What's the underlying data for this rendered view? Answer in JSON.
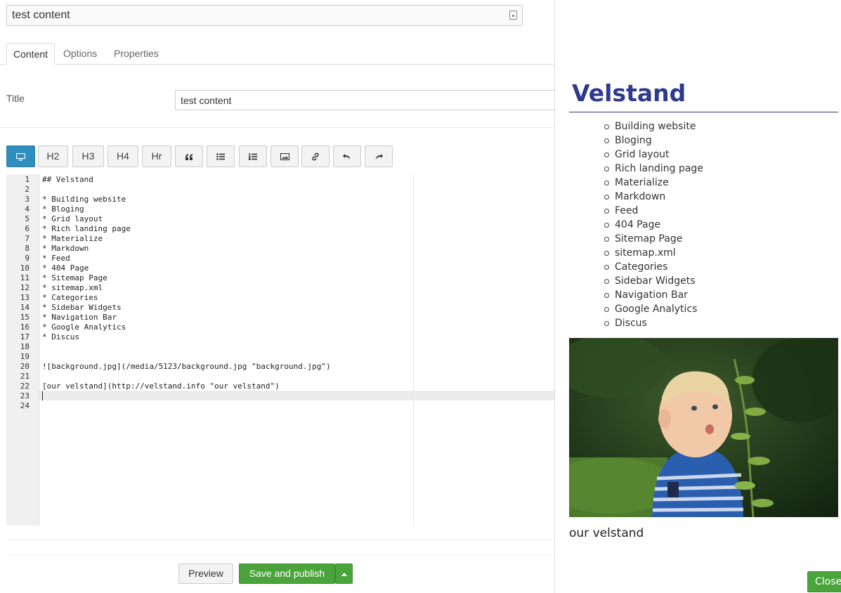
{
  "editor": {
    "name_value": "test content",
    "tabs": [
      {
        "label": "Content"
      },
      {
        "label": "Options"
      },
      {
        "label": "Properties"
      }
    ],
    "title_label": "Title",
    "title_value": "test content",
    "toolbar": {
      "preview_icon": "monitor-icon",
      "h2": "H2",
      "h3": "H3",
      "h4": "H4",
      "hr": "Hr",
      "quote_icon": "quote-icon",
      "ul_icon": "bullet-list-icon",
      "ol_icon": "numbered-list-icon",
      "image_icon": "image-icon",
      "link_icon": "link-icon",
      "undo_icon": "undo-icon",
      "redo_icon": "redo-icon"
    },
    "code_lines": [
      "## Velstand",
      "",
      "* Building website",
      "* Bloging",
      "* Grid layout",
      "* Rich landing page",
      "* Materialize",
      "* Markdown",
      "* Feed",
      "* 404 Page",
      "* Sitemap Page",
      "* sitemap.xml",
      "* Categories",
      "* Sidebar Widgets",
      "* Navigation Bar",
      "* Google Analytics",
      "* Discus",
      "",
      "",
      "![background.jpg](/media/5123/background.jpg \"background.jpg\")",
      "",
      "[our velstand](http://velstand.info \"our velstand\")",
      "",
      ""
    ],
    "line_numbers": [
      "1",
      "2",
      "3",
      "4",
      "5",
      "6",
      "7",
      "8",
      "9",
      "10",
      "11",
      "12",
      "13",
      "14",
      "15",
      "16",
      "17",
      "18",
      "19",
      "20",
      "21",
      "22",
      "23",
      "24"
    ],
    "active_line": 23,
    "buttons": {
      "preview": "Preview",
      "publish": "Save and publish"
    }
  },
  "preview": {
    "title": "Velstand",
    "items": [
      "Building website",
      "Bloging",
      "Grid layout",
      "Rich landing page",
      "Materialize",
      "Markdown",
      "Feed",
      "404 Page",
      "Sitemap Page",
      "sitemap.xml",
      "Categories",
      "Sidebar Widgets",
      "Navigation Bar",
      "Google Analytics",
      "Discus"
    ],
    "link_text": "our velstand",
    "close_label": "Close",
    "colors": {
      "heading": "#2e3a8c",
      "primary_button": "#4aa43b",
      "toolbar_active": "#2e8fbf"
    }
  }
}
